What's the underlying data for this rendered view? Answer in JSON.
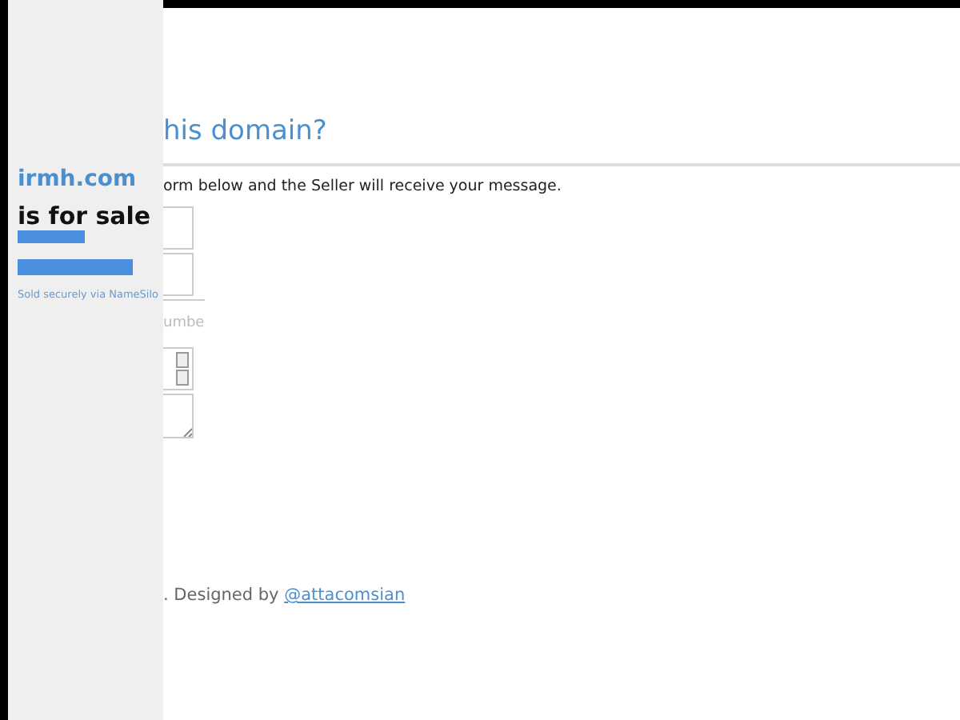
{
  "sidebar": {
    "domain": "irmh.com",
    "tagline": "is for sale",
    "note": "Sold securely via NameSilo"
  },
  "main": {
    "heading": "his domain?",
    "intro": "orm below and the Seller will receive your message.",
    "fields": [
      {
        "kind": "input"
      },
      {
        "kind": "input"
      },
      {
        "kind": "input",
        "placeholder": "umbe"
      },
      {
        "kind": "select"
      },
      {
        "kind": "textarea"
      }
    ],
    "footer_text": ". Designed by",
    "footer_link": "@attacomsian"
  }
}
